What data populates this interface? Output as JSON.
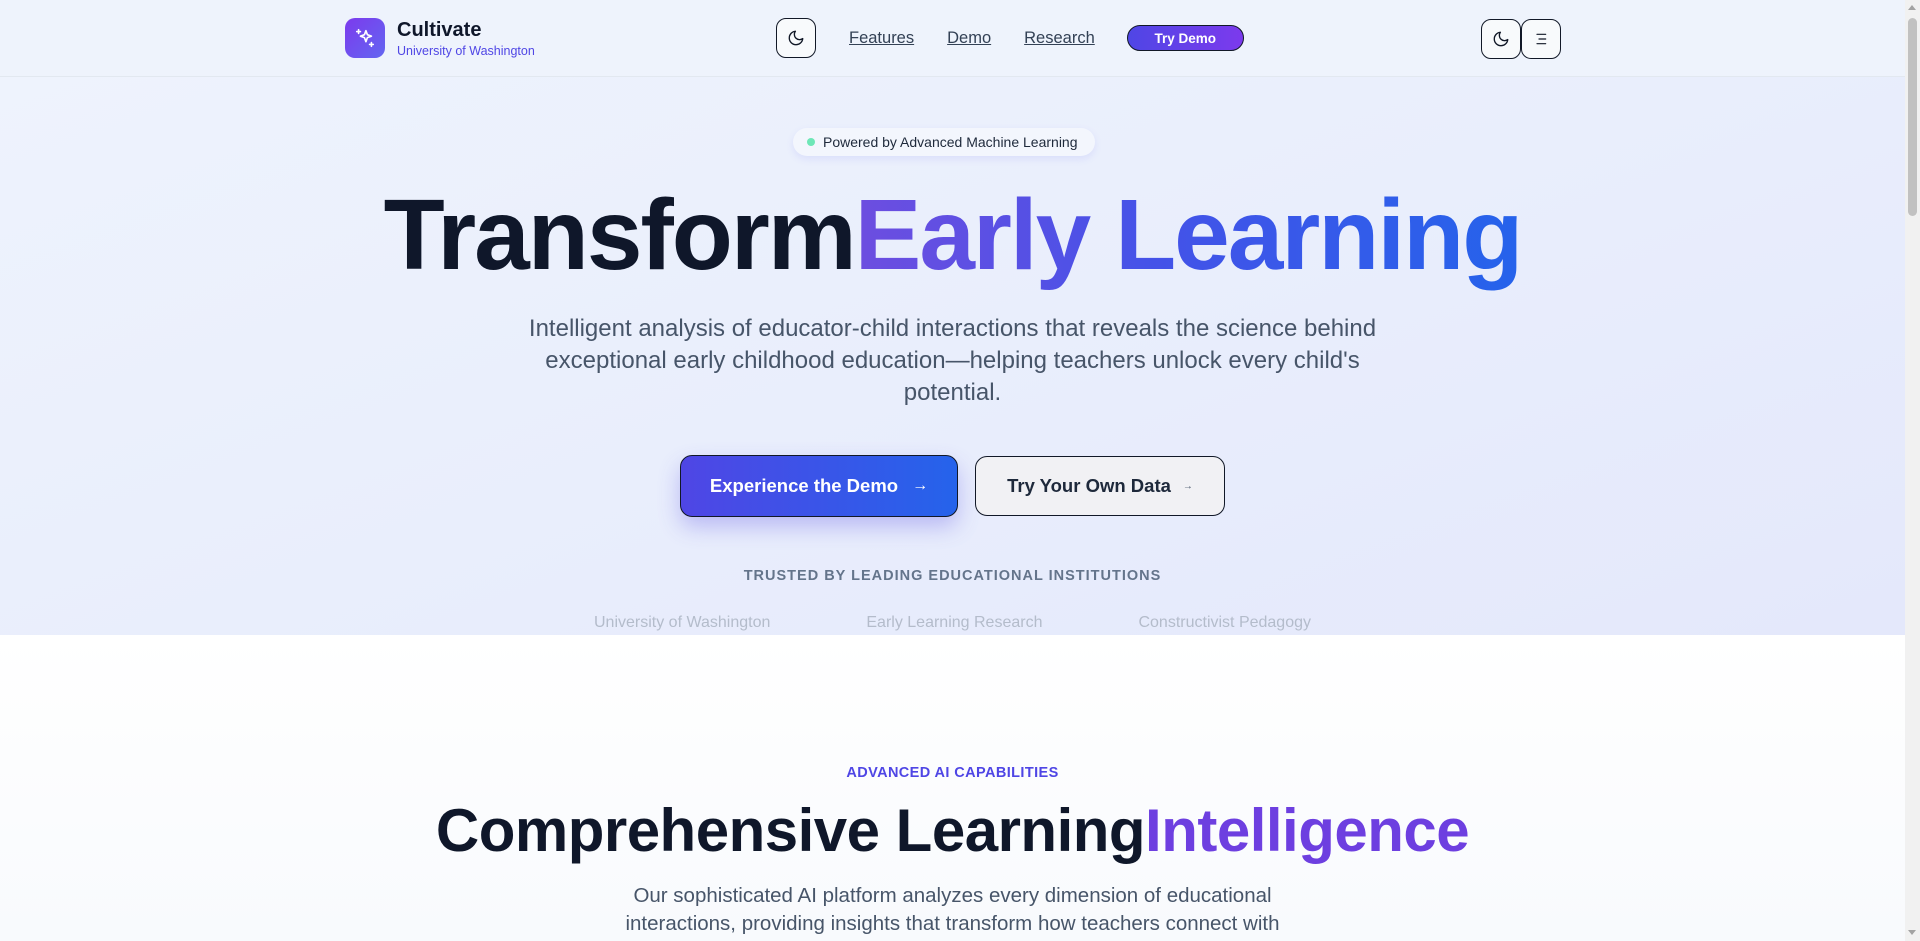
{
  "header": {
    "brand_name": "Cultivate",
    "brand_subtitle": "University of Washington",
    "nav_links": [
      "Features",
      "Demo",
      "Research"
    ],
    "try_demo_label": "Try Demo"
  },
  "hero": {
    "badge": "Powered by Advanced Machine Learning",
    "title_main": "Transform",
    "title_accent": "Early Learning",
    "subtitle": "Intelligent analysis of educator-child interactions that reveals the science behind exceptional early childhood education—helping teachers unlock every child's potential.",
    "primary_cta": "Experience the Demo",
    "secondary_cta": "Try Your Own Data",
    "trusted_label": "TRUSTED BY LEADING EDUCATIONAL INSTITUTIONS",
    "partners": [
      "University of Washington",
      "Early Learning Research",
      "Constructivist Pedagogy"
    ]
  },
  "features": {
    "eyebrow": "ADVANCED AI CAPABILITIES",
    "title_main": "Comprehensive Learning",
    "title_accent": "Intelligence",
    "subtitle": "Our sophisticated AI platform analyzes every dimension of educational interactions, providing insights that transform how teachers connect with"
  },
  "colors": {
    "brand_purple": "#7c3aed",
    "brand_indigo": "#4f46e5",
    "accent_blue": "#2563eb",
    "status_dot": "#6ee7b7"
  },
  "icons": [
    "sparkles-icon",
    "moon-icon",
    "menu-icon",
    "arrow-right-icon"
  ]
}
